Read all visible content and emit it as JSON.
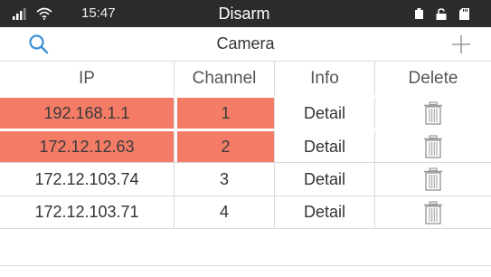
{
  "status_bar": {
    "time": "15:47",
    "mode": "Disarm",
    "icons": [
      "signal-icon",
      "wifi-icon",
      "battery-icon",
      "unlock-icon",
      "sd-card-icon"
    ]
  },
  "header": {
    "title": "Camera",
    "search_icon": "search-icon",
    "add_icon": "plus-icon"
  },
  "table": {
    "columns": [
      "IP",
      "Channel",
      "Info",
      "Delete"
    ],
    "rows": [
      {
        "ip": "192.168.1.1",
        "channel": "1",
        "info": "Detail",
        "highlighted": true
      },
      {
        "ip": "172.12.12.63",
        "channel": "2",
        "info": "Detail",
        "highlighted": true
      },
      {
        "ip": "172.12.103.74",
        "channel": "3",
        "info": "Detail",
        "highlighted": false
      },
      {
        "ip": "172.12.103.71",
        "channel": "4",
        "info": "Detail",
        "highlighted": false
      }
    ]
  },
  "colors": {
    "status_bar_bg": "#2b2b2b",
    "accent_blue": "#3a8fd8",
    "highlight": "#f47c66",
    "divider": "#d9d9d9"
  }
}
